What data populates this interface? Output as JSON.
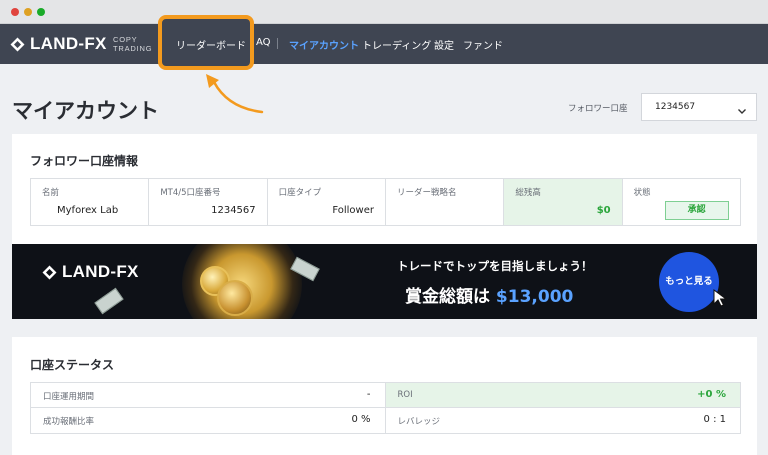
{
  "nav": {
    "logo_text": "LAND-FX",
    "copy_line1": "COPY",
    "copy_line2": "TRADING",
    "leaderboard": "リーダーボード",
    "faq_partial": "AQ",
    "myaccount": "マイアカウント",
    "trading": "トレーディング",
    "settings": "設定",
    "fund": "ファンド"
  },
  "page": {
    "title": "マイアカウント",
    "follower_account_label": "フォロワー口座",
    "follower_account_value": "1234567"
  },
  "follower_info": {
    "title": "フォロワー口座情報",
    "cells": [
      {
        "label": "名前",
        "value": "Myforex Lab"
      },
      {
        "label": "MT4/5口座番号",
        "value": "1234567"
      },
      {
        "label": "口座タイプ",
        "value": "Follower"
      },
      {
        "label": "リーダー戦略名",
        "value": ""
      },
      {
        "label": "総残高",
        "value": "$0"
      },
      {
        "label": "状態",
        "value": "承認"
      }
    ]
  },
  "banner": {
    "logo_text": "LAND-FX",
    "line1": "トレードでトップを目指しましょう！",
    "line2_prefix": "賞金総額は",
    "line2_amount": "$13,000",
    "button": "もっと見る"
  },
  "account_status": {
    "title": "口座ステータス",
    "rows": [
      {
        "left_label": "口座運用期間",
        "left_value": "-",
        "right_label": "ROI",
        "right_value": "+0 %"
      },
      {
        "left_label": "成功報酬比率",
        "left_value": "0 %",
        "right_label": "レバレッジ",
        "right_value": "0 : 1"
      }
    ]
  },
  "colors": {
    "accent_orange": "#f39a1e",
    "nav_bg": "#3f4552",
    "active_blue": "#5aa2ff",
    "positive_green": "#2aa53b",
    "button_blue": "#1f55e0"
  }
}
